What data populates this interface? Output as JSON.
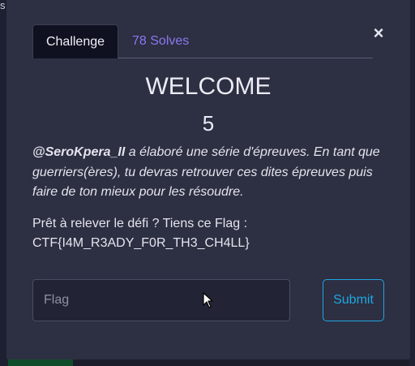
{
  "backdrop": {
    "glyph": "s"
  },
  "modal": {
    "close_label": "×",
    "tabs": [
      {
        "label": "Challenge",
        "active": true
      },
      {
        "label": "78 Solves",
        "active": false
      }
    ],
    "challenge": {
      "name": "WELCOME",
      "value": "5",
      "author": "@SeroKpera_II",
      "description": " a élaboré une série d'épreuves. En tant que guerriers(ères), tu devras retrouver ces dites épreuves puis faire de ton mieux pour les résoudre.",
      "flag_prompt": "Prêt à relever le défi ? Tiens ce Flag :",
      "flag_value": "CTF{I4M_R3ADY_F0R_TH3_CH4LL}"
    },
    "form": {
      "flag_placeholder": "Flag",
      "submit_label": "Submit"
    }
  },
  "colors": {
    "accent": "#8a78f0",
    "submit": "#1ea7e0",
    "modal_bg": "#2d2f42"
  }
}
